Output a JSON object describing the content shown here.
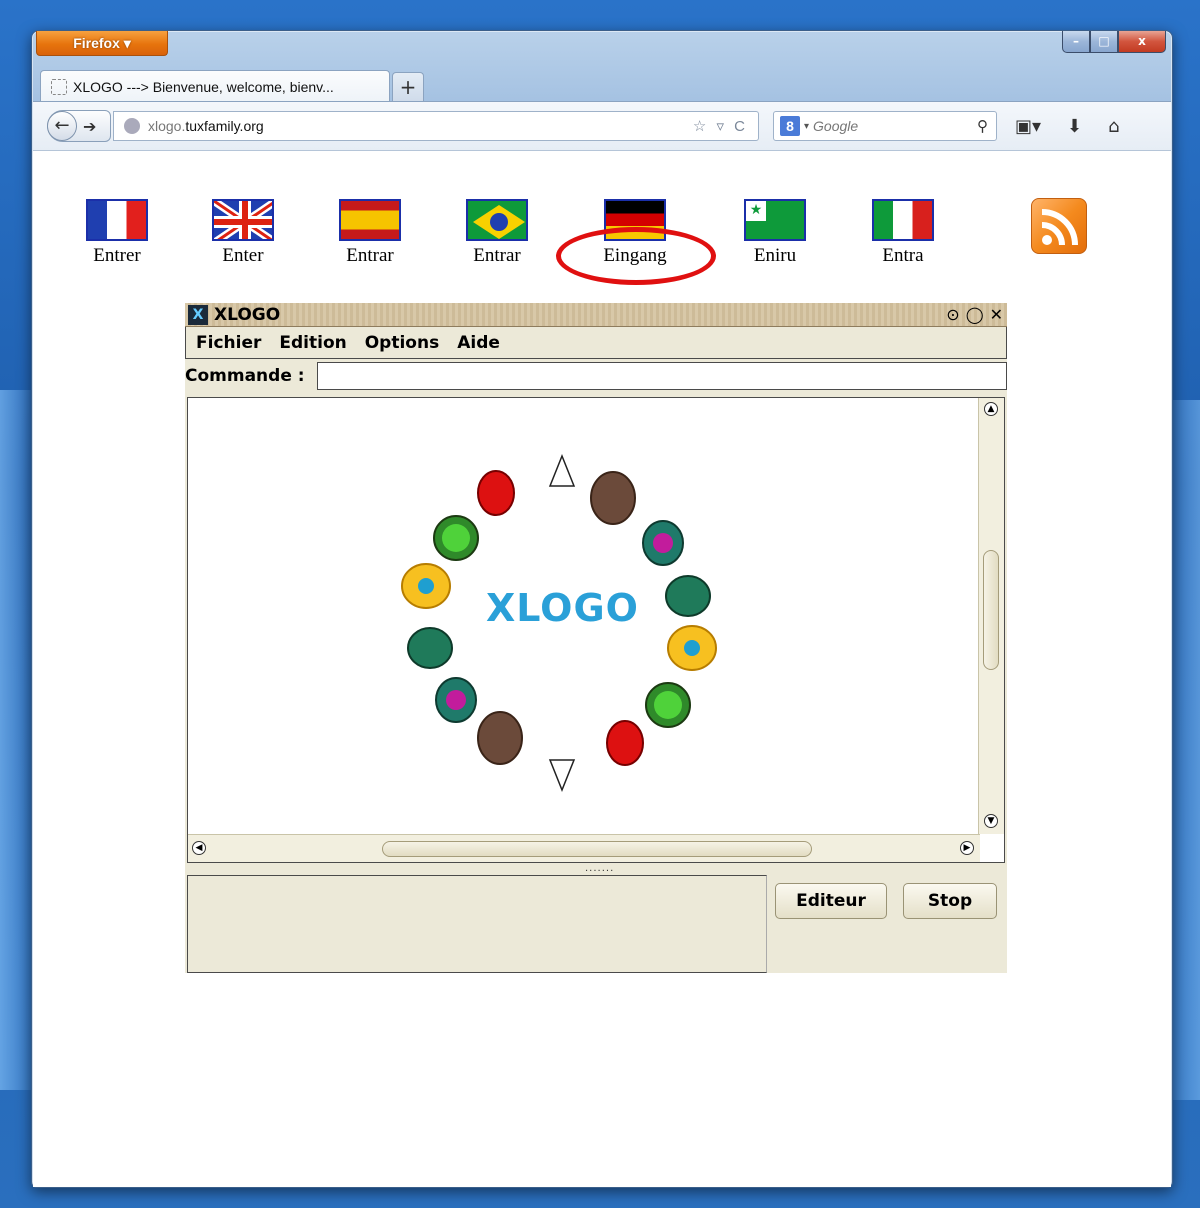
{
  "browser": {
    "app_button": "Firefox ▾",
    "window_controls": {
      "minimize": "–",
      "maximize": "□",
      "close": "x"
    },
    "tab": {
      "title": "XLOGO ---> Bienvenue, welcome, bienv...",
      "new_tab": "+"
    },
    "url": {
      "host_prefix": "xlogo.",
      "domain": "tuxfamily.org",
      "right_icons": "☆ ▿ C"
    },
    "search": {
      "engine_icon": "8",
      "placeholder": "Google",
      "magnifier": "⚲"
    },
    "toolbar_icons": [
      "bookmark-icon",
      "download-icon",
      "home-icon"
    ]
  },
  "languages": [
    {
      "label": "Entrer",
      "flag": "france"
    },
    {
      "label": "Enter",
      "flag": "uk"
    },
    {
      "label": "Entrar",
      "flag": "spain"
    },
    {
      "label": "Entrar",
      "flag": "brazil"
    },
    {
      "label": "Eingang",
      "flag": "germany"
    },
    {
      "label": "Eniru",
      "flag": "esperanto"
    },
    {
      "label": "Entra",
      "flag": "italy"
    }
  ],
  "annotation": {
    "color": "#e01010"
  },
  "xlogo": {
    "title": "XLOGO",
    "menu": [
      "Fichier",
      "Edition",
      "Options",
      "Aide"
    ],
    "command_label": "Commande :",
    "command_value": "",
    "canvas_text": "XLOGO",
    "editor_button": "Editeur",
    "stop_button": "Stop",
    "grip": "......."
  },
  "colors": {
    "canvas_text": "#2aa0d8",
    "firefox_orange": "#e7740d"
  }
}
